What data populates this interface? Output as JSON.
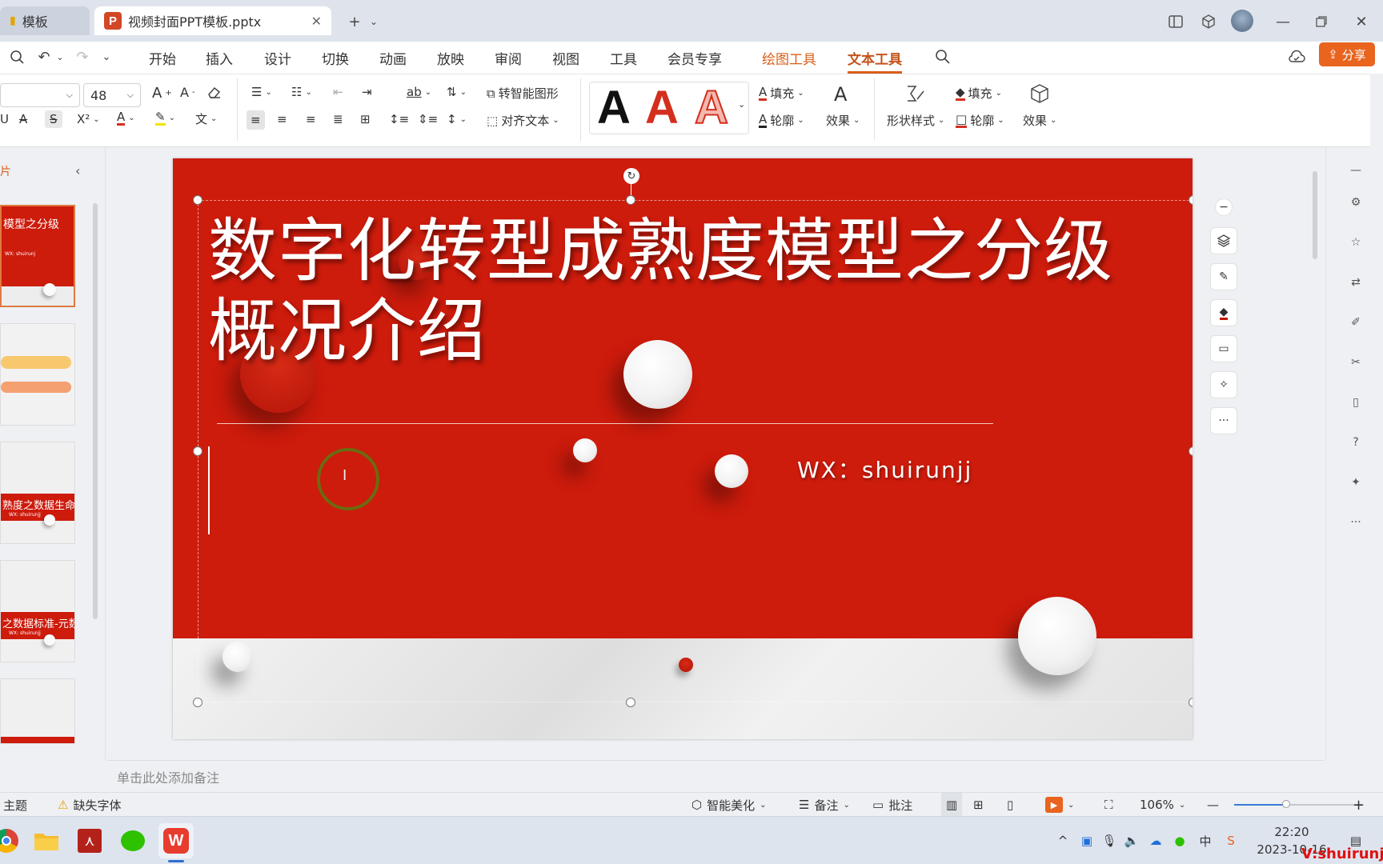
{
  "window": {
    "tab_inactive_label": "模板",
    "tab_active_label": "视频封面PPT模板.pptx",
    "tab_active_icon": "P"
  },
  "menu": {
    "items": [
      "开始",
      "插入",
      "设计",
      "切换",
      "动画",
      "放映",
      "审阅",
      "视图",
      "工具",
      "会员专享"
    ],
    "context_tabs": [
      "绘图工具",
      "文本工具"
    ],
    "share_label": "分享"
  },
  "ribbon": {
    "font_size": "48",
    "smart_shape": "转智能图形",
    "align_text": "对齐文本",
    "fill": "填充",
    "outline": "轮廓",
    "effect": "效果",
    "shape_style": "形状样式",
    "shape_fill": "填充",
    "shape_outline": "轮廓",
    "shape_effect": "效果",
    "style_letters": [
      "A",
      "A",
      "A"
    ],
    "colors": {
      "accent": "#d9601a",
      "text_red": "#d32f1f",
      "highlight": "#f4e000"
    }
  },
  "left_pane": {
    "header": "片",
    "thumbs": [
      {
        "title": "模型之分级",
        "sub": "WX: shuirunj"
      },
      {
        "title": "",
        "sub": ""
      },
      {
        "title": "熟度之数据生命",
        "sub": "WX: shuirunjj"
      },
      {
        "title": "之数据标准-元数",
        "sub": "WX: shuirunjj"
      },
      {
        "title": "",
        "sub": ""
      }
    ]
  },
  "slide": {
    "title_line1": "数字化转型成熟度模型之分级",
    "title_line2": "概况介绍",
    "subtitle": "WX：shuirunjj",
    "cursor_glyph": "I",
    "background_red": "#cd1b0c"
  },
  "float_more": "···",
  "right_more": "···",
  "notes_placeholder": "单击此处添加备注",
  "status": {
    "theme": "主题",
    "missing_font": "缺失字体",
    "smart_beautify": "智能美化",
    "notes": "备注",
    "comments": "批注",
    "zoom": "106%"
  },
  "tray": {
    "ime": "中",
    "time": "22:20",
    "date": "2023-10-16",
    "watermark": "V:shuirunjj"
  }
}
